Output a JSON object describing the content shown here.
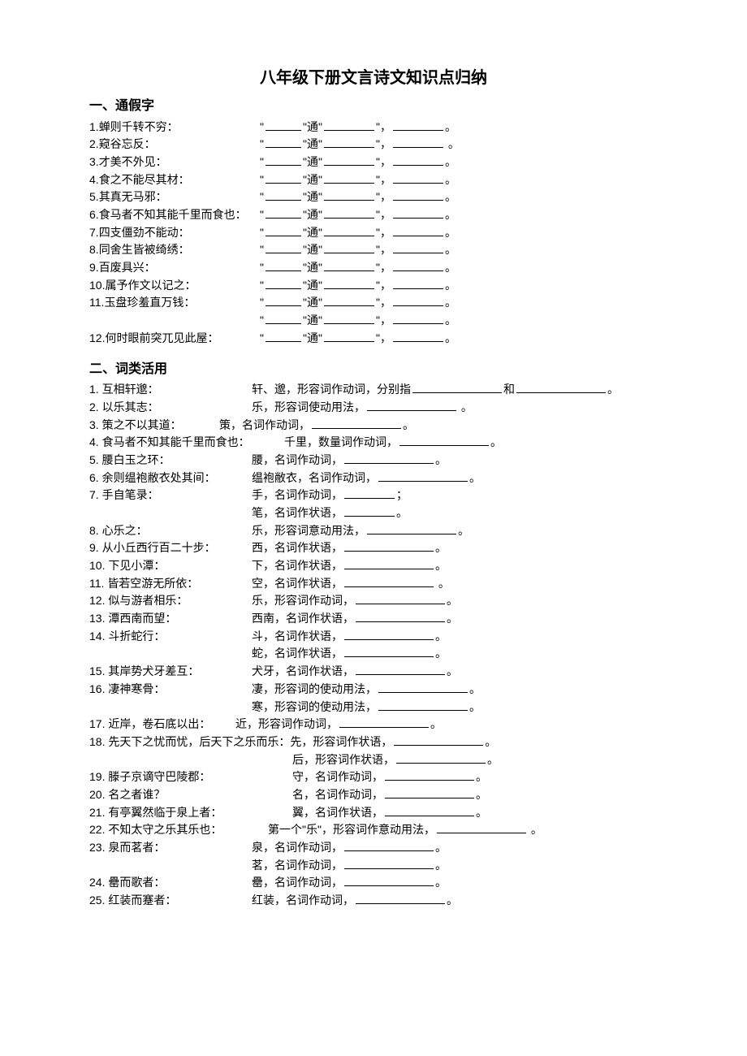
{
  "title": "八年级下册文言诗文知识点归纳",
  "section1": {
    "heading": "一、通假字",
    "tong": "通",
    "items": [
      {
        "n": "1.",
        "text": "蝉则千转不穷："
      },
      {
        "n": "2.",
        "text": "窥谷忘反："
      },
      {
        "n": "3.",
        "text": "才美不外见："
      },
      {
        "n": "4.",
        "text": "食之不能尽其材："
      },
      {
        "n": "5.",
        "text": "其真无马邪："
      },
      {
        "n": "6.",
        "text": "食马者不知其能千里而食也："
      },
      {
        "n": "7.",
        "text": "四支僵劲不能动："
      },
      {
        "n": "8.",
        "text": "同舍生皆被绮绣："
      },
      {
        "n": "9.",
        "text": "百废具兴："
      },
      {
        "n": "10.",
        "text": "属予作文以记之："
      },
      {
        "n": "11.",
        "text": "玉盘珍羞直万钱："
      },
      {
        "n": "",
        "text": ""
      },
      {
        "n": "12.",
        "text": "何时眼前突兀见此屋："
      }
    ]
  },
  "section2": {
    "heading": "二、词类活用",
    "items": {
      "i1": {
        "label": "1. 互相轩邈：",
        "body": "轩、邈，形容词作动词，分别指"
      },
      "i1b": {
        "mid": "和"
      },
      "i2": {
        "label": "2. 以乐其志：",
        "body": "乐，形容词使动用法，"
      },
      "i3": {
        "label": "3. 策之不以其道：",
        "body": "策，名词作动词，"
      },
      "i4": {
        "label": "4. 食马者不知其能千里而食也：",
        "body": "千里，数量词作动词，"
      },
      "i5": {
        "label": "5. 腰白玉之环：",
        "body": "腰，名词作动词，"
      },
      "i6": {
        "label": "6. 余则缊袍敝衣处其间：",
        "body": "缊袍敝衣，名词作动词，"
      },
      "i7": {
        "label": "7. 手自笔录：",
        "body": "手，名词作动词，"
      },
      "i7b": {
        "body": "笔，名词作状语，"
      },
      "i8": {
        "label": "8. 心乐之：",
        "body": "乐，形容词意动用法，"
      },
      "i9": {
        "label": "9. 从小丘西行百二十步：",
        "body": "西，名词作状语，"
      },
      "i10": {
        "label": "10. 下见小潭：",
        "body": "下，名词作状语，"
      },
      "i11": {
        "label": "11. 皆若空游无所依：",
        "body": "空，名词作状语，"
      },
      "i12": {
        "label": "12. 似与游者相乐：",
        "body": "乐，形容词作动词，"
      },
      "i13": {
        "label": "13. 潭西南而望：",
        "body": "西南，名词作状语，"
      },
      "i14": {
        "label": "14. 斗折蛇行：",
        "body": "斗，名词作状语，"
      },
      "i14b": {
        "body": "蛇，名词作状语，"
      },
      "i15": {
        "label": "15. 其岸势犬牙差互：",
        "body": "犬牙，名词作状语，"
      },
      "i16": {
        "label": "16. 凄神寒骨：",
        "body": "凄，形容词的使动用法，"
      },
      "i16b": {
        "body": "寒，形容词的使动用法，"
      },
      "i17": {
        "label": "17. 近岸，卷石底以出：",
        "body": "近，形容词作动词，"
      },
      "i18": {
        "label": "18. 先天下之忧而忧，后天下之乐而乐：先，形容词作状语，"
      },
      "i18b": {
        "body": "后，形容词作状语，"
      },
      "i19": {
        "label": "19. 滕子京谪守巴陵郡：",
        "body": "守，名词作动词，"
      },
      "i20": {
        "label": "20. 名之者谁？",
        "body": "名，名词作动词，"
      },
      "i21": {
        "label": "21. 有亭翼然临于泉上者：",
        "body": "翼，名词作状语，"
      },
      "i22": {
        "label": "22. 不知太守之乐其乐也：",
        "body": "第一个\"乐\"，形容词作意动用法，"
      },
      "i23": {
        "label": "23. 泉而茗者：",
        "body": "泉，名词作动词，"
      },
      "i23b": {
        "body": "茗，名词作动词，"
      },
      "i24": {
        "label": "24. 罍而歌者：",
        "body": "罍，名词作动词，"
      },
      "i25": {
        "label": "25. 红装而蹇者：",
        "body": "红装，名词作动词，"
      }
    }
  },
  "punct": {
    "period": "。",
    "semicolon": "；",
    "comma": "，",
    "space": " ",
    "lq": "\"",
    "rq": "\""
  }
}
